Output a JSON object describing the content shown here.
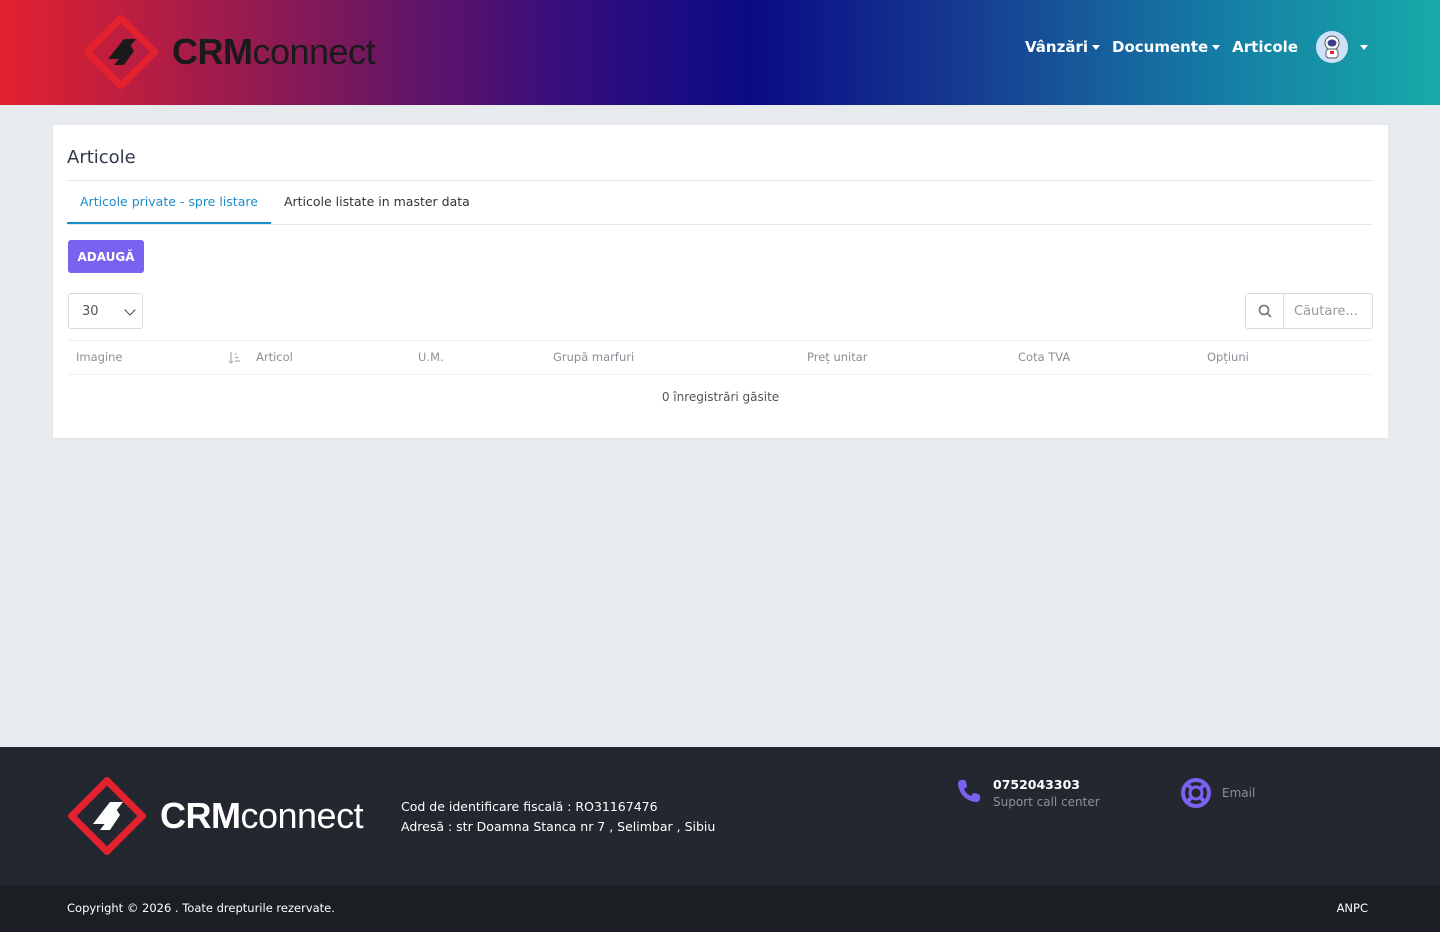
{
  "header": {
    "logo": {
      "bold": "CRM",
      "rest": "connect"
    },
    "nav": [
      {
        "label": "Vânzări",
        "has_caret": true
      },
      {
        "label": "Documente",
        "has_caret": true
      },
      {
        "label": "Articole",
        "has_caret": false
      }
    ],
    "avatar_icon": "astronaut-avatar"
  },
  "page": {
    "title": "Articole",
    "tabs": [
      {
        "label": "Articole private - spre listare",
        "active": true
      },
      {
        "label": "Articole listate in master data",
        "active": false
      }
    ],
    "add_button": "ADAUGĂ",
    "page_size": "30",
    "search_placeholder": "Căutare...",
    "table": {
      "columns": [
        "Imagine",
        "Articol",
        "U.M.",
        "Grupă marfuri",
        "Preț unitar",
        "Cota TVA",
        "Opțiuni"
      ],
      "empty_message": "0 înregistrări găsite"
    }
  },
  "footer": {
    "logo": {
      "bold": "CRM",
      "rest": "connect"
    },
    "fiscal": "Cod de identificare fiscală : RO31167476",
    "address": "Adresă : str Doamna Stanca nr 7 , Selimbar , Sibiu",
    "phone": "0752043303",
    "phone_sub": "Suport call center",
    "email_label": "Email",
    "copyright": "Copyright © 2026 . Toate drepturile rezervate.",
    "anpc": "ANPC"
  },
  "colors": {
    "accent_button": "#7b61f0",
    "tab_active": "#1a8ec8",
    "brand_red": "#e4212f"
  }
}
